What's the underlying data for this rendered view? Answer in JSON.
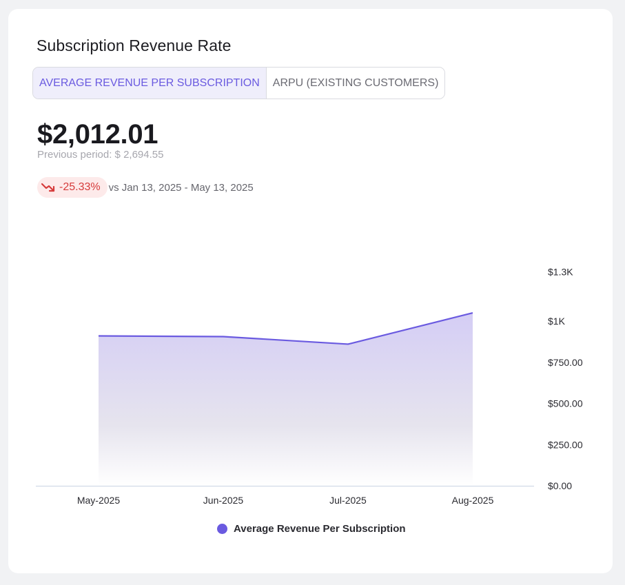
{
  "card": {
    "title": "Subscription Revenue Rate",
    "tabs": [
      {
        "label": "AVERAGE REVENUE PER SUBSCRIPTION",
        "active": true
      },
      {
        "label": "ARPU (EXISTING CUSTOMERS)",
        "active": false
      }
    ],
    "value": "$2,012.01",
    "previous": "Previous period: $ 2,694.55",
    "change": "-25.33%",
    "comparison": "vs Jan 13, 2025 - May 13, 2025",
    "change_icon": "trend-down-icon"
  },
  "colors": {
    "accent": "#6a5ae0",
    "negative": "#d63b3b",
    "negative_bg": "#fdeaea"
  },
  "chart_data": {
    "type": "area",
    "categories": [
      "May-2025",
      "Jun-2025",
      "Jul-2025",
      "Aug-2025"
    ],
    "series": [
      {
        "name": "Average Revenue Per Subscription",
        "values": [
          910,
          906,
          860,
          1050
        ]
      }
    ],
    "y_ticks": [
      {
        "value": 1300,
        "label": "$1.3K"
      },
      {
        "value": 1000,
        "label": "$1K"
      },
      {
        "value": 750,
        "label": "$750.00"
      },
      {
        "value": 500,
        "label": "$500.00"
      },
      {
        "value": 250,
        "label": "$250.00"
      },
      {
        "value": 0,
        "label": "$0.00"
      }
    ],
    "ylim": [
      0,
      1250
    ],
    "y_axis_position": "right",
    "grid": false,
    "legend": "bottom-center"
  }
}
